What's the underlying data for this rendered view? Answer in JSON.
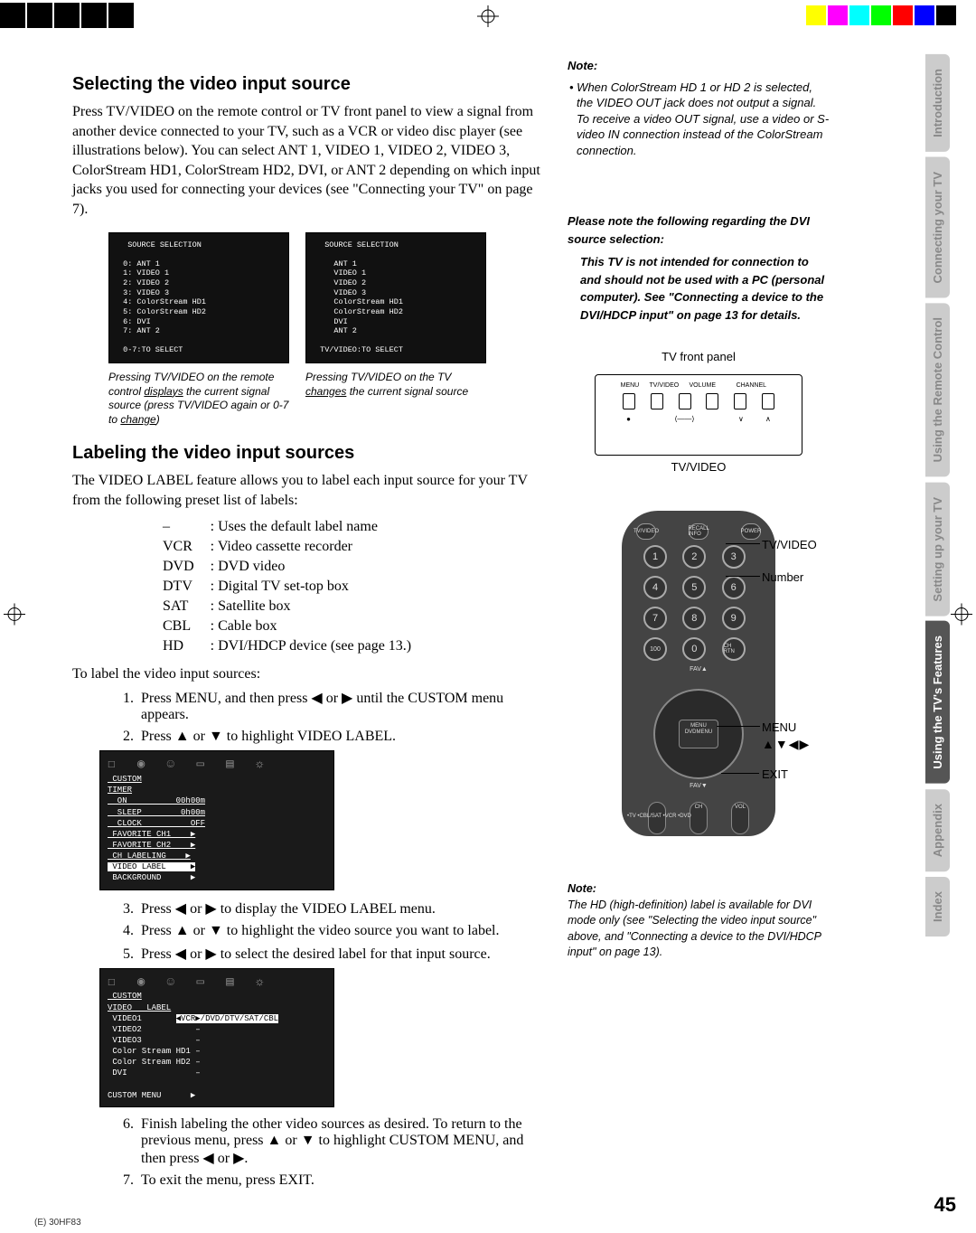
{
  "page_number": "45",
  "foot_code": "(E) 30HF83",
  "section1": {
    "heading": "Selecting the video input source",
    "para": "Press TV/VIDEO on the remote control or  TV front panel to view a signal from another device connected to your TV, such as a VCR or video disc player (see illustrations below). You can select ANT 1, VIDEO 1, VIDEO 2, VIDEO 3, ColorStream HD1, ColorStream HD2, DVI, or ANT 2 depending on which input jacks you used for connecting your devices (see \"Connecting your TV\" on page 7).",
    "osd_left": "  SOURCE SELECTION\n\n 0: ANT 1\n 1: VIDEO 1\n 2: VIDEO 2\n 3: VIDEO 3\n 4: ColorStream HD1\n 5: ColorStream HD2\n 6: DVI\n 7: ANT 2\n\n 0-7:TO SELECT",
    "osd_right": "  SOURCE SELECTION\n\n    ANT 1\n    VIDEO 1\n    VIDEO 2\n    VIDEO 3\n    ColorStream HD1\n    ColorStream HD2\n    DVI\n    ANT 2\n\n TV/VIDEO:TO SELECT",
    "cap_left_1": "Pressing TV/VIDEO on the remote control ",
    "cap_left_u": "displays",
    "cap_left_2": " the current signal source (press TV/VIDEO again or 0-7 to ",
    "cap_left_u2": "change",
    "cap_left_3": ")",
    "cap_right_1": "Pressing TV/VIDEO on the TV ",
    "cap_right_u": "changes",
    "cap_right_2": " the current signal source"
  },
  "section2": {
    "heading": "Labeling the video input sources",
    "para": "The VIDEO LABEL feature allows you to label each input source for your TV from the following preset list of labels:",
    "labels": [
      {
        "k": "–",
        "v": ": Uses the default label name"
      },
      {
        "k": "VCR",
        "v": ": Video cassette recorder"
      },
      {
        "k": "DVD",
        "v": ": DVD video"
      },
      {
        "k": "DTV",
        "v": ": Digital TV set-top box"
      },
      {
        "k": "SAT",
        "v": ": Satellite box"
      },
      {
        "k": "CBL",
        "v": ": Cable box"
      },
      {
        "k": "HD",
        "v": ": DVI/HDCP device (see page 13.)"
      }
    ],
    "lead": "To label the video input sources:",
    "steps": [
      "Press MENU, and then press ◀ or ▶ until the CUSTOM menu appears.",
      "Press ▲ or ▼ to highlight VIDEO LABEL."
    ],
    "menu1_tabs": "☐ ◉ ☺ ▭ ▤ ☼",
    "menu1": " CUSTOM\nTIMER\n  ON          00h00m\n  SLEEP        0h00m\n  CLOCK          OFF\n FAVORITE CH1    ▶\n FAVORITE CH2    ▶\n CH LABELING    ▶",
    "menu1_hl": " VIDEO LABEL     ▶",
    "menu1_tail": " BACKGROUND      ▶",
    "steps2": [
      "Press ◀ or ▶ to display the VIDEO LABEL menu.",
      "Press ▲ or ▼ to highlight the video source you want to label.",
      "Press ◀ or ▶ to select the desired label for that input source."
    ],
    "menu2": " CUSTOM\nVIDEO   LABEL",
    "menu2_row1_a": " VIDEO1       ",
    "menu2_row1_hl": "◀VCR▶/DVD/DTV/SAT/CBL",
    "menu2_tail": " VIDEO2           –\n VIDEO3           –\n Color Stream HD1 –\n Color Stream HD2 –\n DVI              –\n\nCUSTOM MENU      ▶",
    "steps3": [
      "Finish labeling the other video sources as desired. To return to the previous menu, press ▲ or ▼ to highlight CUSTOM MENU, and then press ◀ or ▶.",
      "To exit the menu, press EXIT."
    ]
  },
  "rightcol": {
    "note1_head": "Note:",
    "note1": "When ColorStream HD 1 or HD 2 is selected, the VIDEO OUT jack does not output a signal. To receive a video OUT signal, use a video or S-video IN connection instead of the ColorStream connection.",
    "dvi_head": "Please note the following regarding the DVI source selection:",
    "dvi_body": "This TV is not intended for connection to and should not be used with a PC (personal computer). See \"Connecting a device to the DVI/HDCP input\" on page 13 for details.",
    "fp_title": "TV front panel",
    "fp_caption": "TV/VIDEO",
    "fp_labels": [
      "MENU",
      "TV/VIDEO",
      "VOLUME",
      "",
      "CHANNEL",
      ""
    ],
    "fp_syms": [
      "●",
      "",
      "⟨——⟩",
      "",
      "∨",
      "∧"
    ],
    "rc_callouts": {
      "tvvideo": "TV/VIDEO",
      "number": "Number",
      "menu": "MENU",
      "arrows": "▲▼◀▶",
      "exit": "EXIT"
    },
    "rc_top": [
      "TV/VIDEO",
      "RECALL\nINFO",
      "POWER"
    ],
    "rc_nums": [
      "1",
      "2",
      "3",
      "4",
      "5",
      "6",
      "7",
      "8",
      "9",
      "100",
      "0",
      "CH RTN"
    ],
    "rc_menu": "MENU\nDVDMENU",
    "rc_side": "•TV\n•CBL/SAT\n•VCR\n•DVD",
    "note2_head": "Note:",
    "note2": "The HD (high-definition) label is available for DVI mode only (see \"Selecting the video input source\" above, and \"Connecting a device to the DVI/HDCP input\" on page 13)."
  },
  "tabs": {
    "t1": "Introduction",
    "t2": "Connecting your TV",
    "t3": "Using the Remote Control",
    "t4": "Setting up your TV",
    "t5": "Using the TV's Features",
    "t6": "Appendix",
    "t7": "Index"
  }
}
